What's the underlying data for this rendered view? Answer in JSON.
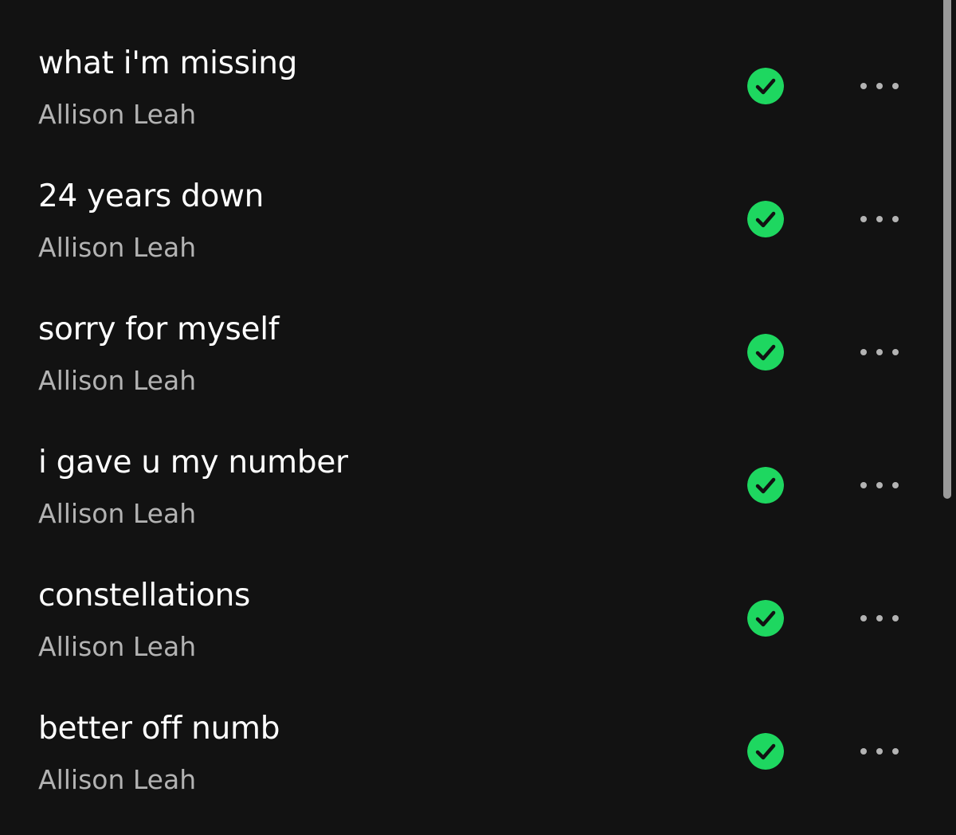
{
  "colors": {
    "background": "#121212",
    "title": "#ffffff",
    "artist": "#b3b3b3",
    "downloaded_accent": "#1ed760",
    "more_dots": "#b3b3b3",
    "scrollbar": "#9a9a9a"
  },
  "icons": {
    "downloaded": "check-circle-icon",
    "more": "more-horizontal-icon"
  },
  "tracks": [
    {
      "title": "what i'm missing",
      "artist": "Allison Leah"
    },
    {
      "title": "24 years down",
      "artist": "Allison Leah"
    },
    {
      "title": "sorry for myself",
      "artist": "Allison Leah"
    },
    {
      "title": "i gave u my number",
      "artist": "Allison Leah"
    },
    {
      "title": "constellations",
      "artist": "Allison Leah"
    },
    {
      "title": "better off numb",
      "artist": "Allison Leah"
    }
  ]
}
